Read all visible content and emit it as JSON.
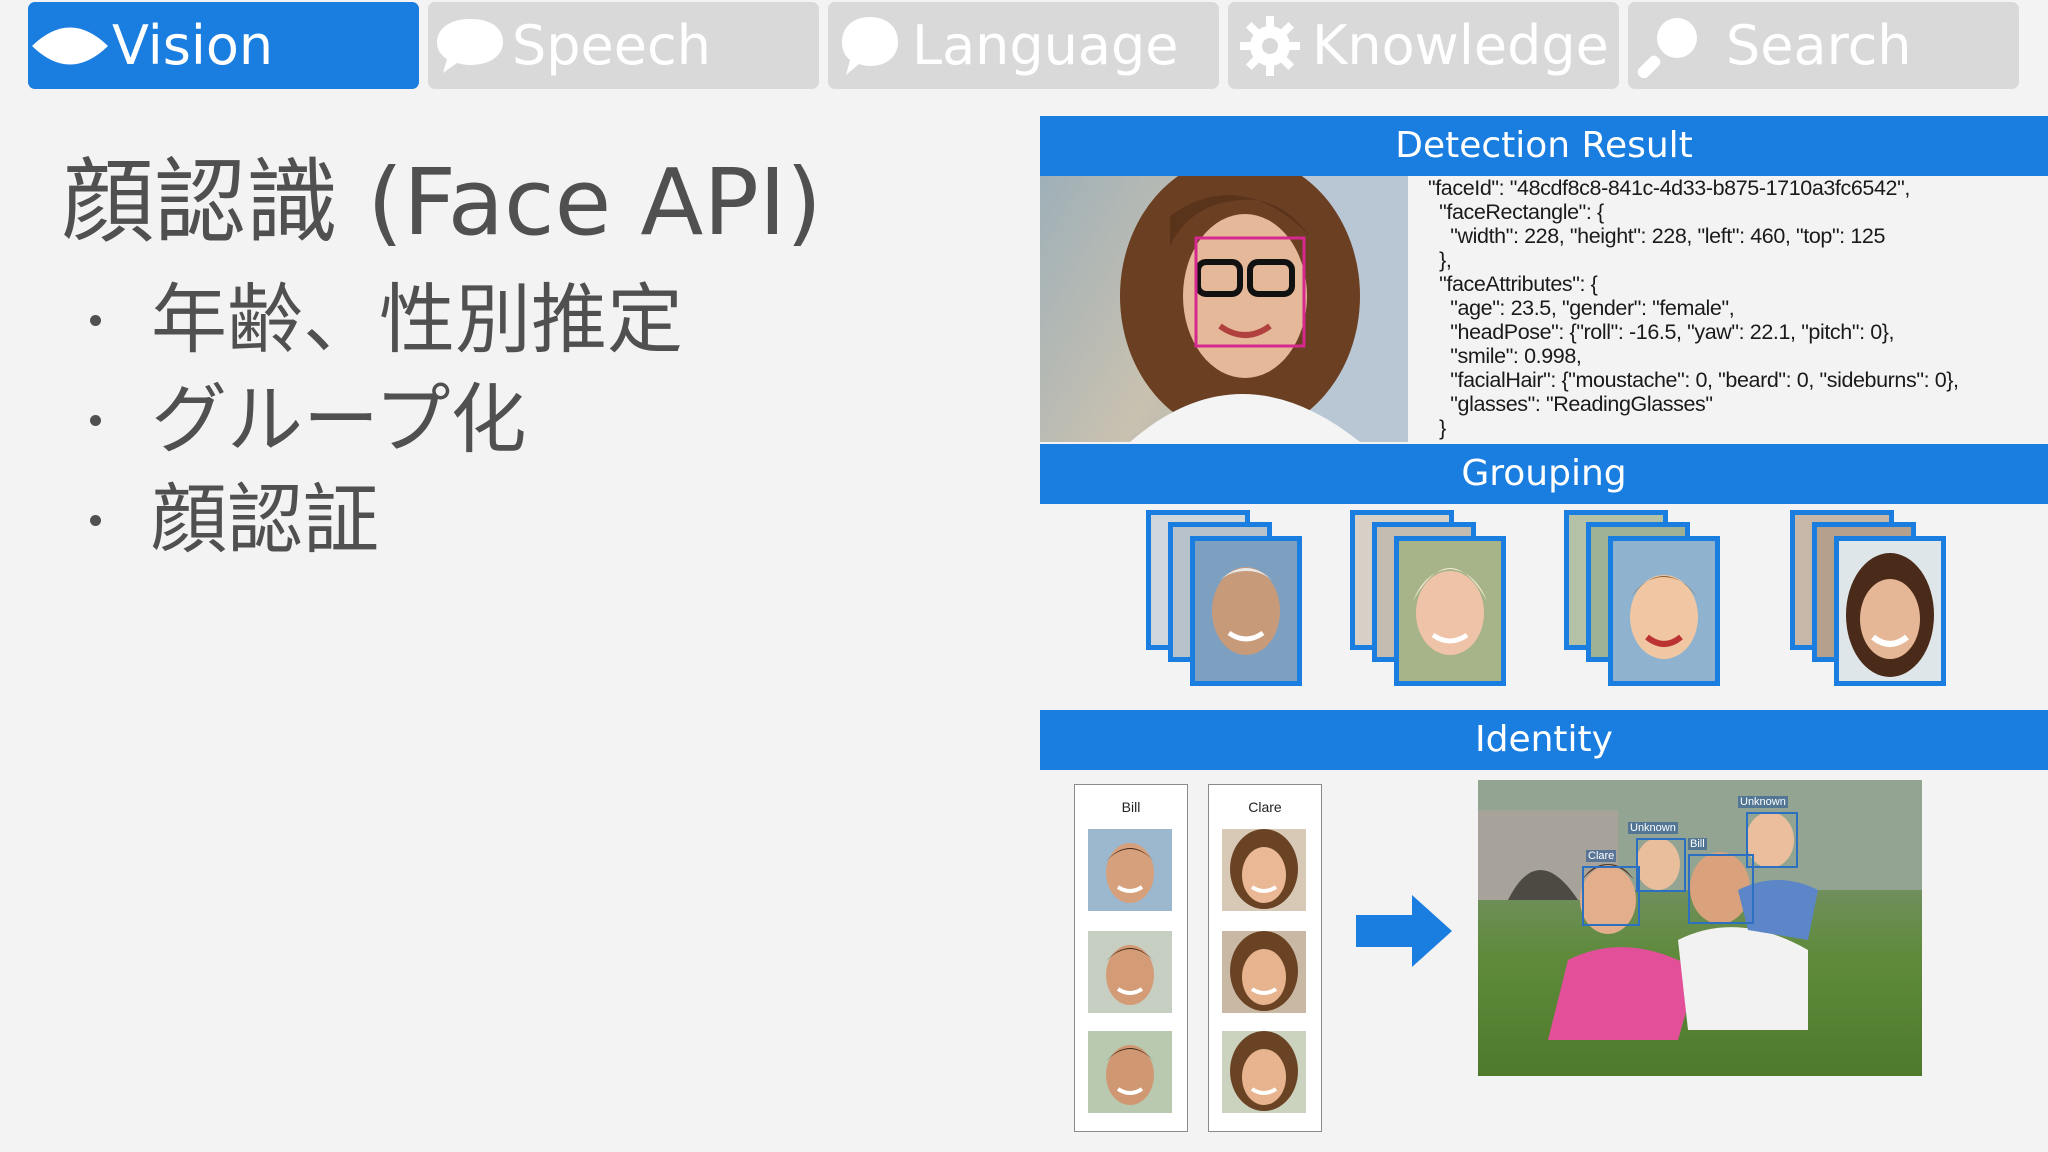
{
  "tabs": [
    {
      "label": "Vision",
      "icon": "eye-icon",
      "active": true
    },
    {
      "label": "Speech",
      "icon": "speech-bubble-icon",
      "active": false
    },
    {
      "label": "Language",
      "icon": "language-bubble-icon",
      "active": false
    },
    {
      "label": "Knowledge",
      "icon": "gear-icon",
      "active": false
    },
    {
      "label": "Search",
      "icon": "search-icon",
      "active": false
    }
  ],
  "title": "顔認識 (Face API)",
  "bullets": [
    "年齢、性別推定",
    "グループ化",
    "顔認証"
  ],
  "panels": {
    "detection": {
      "header": "Detection Result",
      "json_lines": [
        "\"faceId\": \"48cdf8c8-841c-4d33-b875-1710a3fc6542\",",
        "  \"faceRectangle\": {",
        "    \"width\": 228, \"height\": 228, \"left\": 460, \"top\": 125",
        "  },",
        "  \"faceAttributes\": {",
        "    \"age\": 23.5, \"gender\": \"female\",",
        "    \"headPose\": {\"roll\": -16.5, \"yaw\": 22.1, \"pitch\": 0},",
        "    \"smile\": 0.998,",
        "    \"facialHair\": {\"moustache\": 0, \"beard\": 0, \"sideburns\": 0},",
        "    \"glasses\": \"ReadingGlasses\"",
        "  }"
      ]
    },
    "grouping": {
      "header": "Grouping"
    },
    "identity": {
      "header": "Identity",
      "people": [
        "Bill",
        "Clare"
      ],
      "photo_labels": [
        "Clare",
        "Unknown",
        "Bill",
        "Unknown"
      ]
    }
  },
  "colors": {
    "accent": "#1a7ee0",
    "tab_inactive": "#d9d9d9",
    "text": "#505050",
    "face_box": "#d6288f"
  }
}
